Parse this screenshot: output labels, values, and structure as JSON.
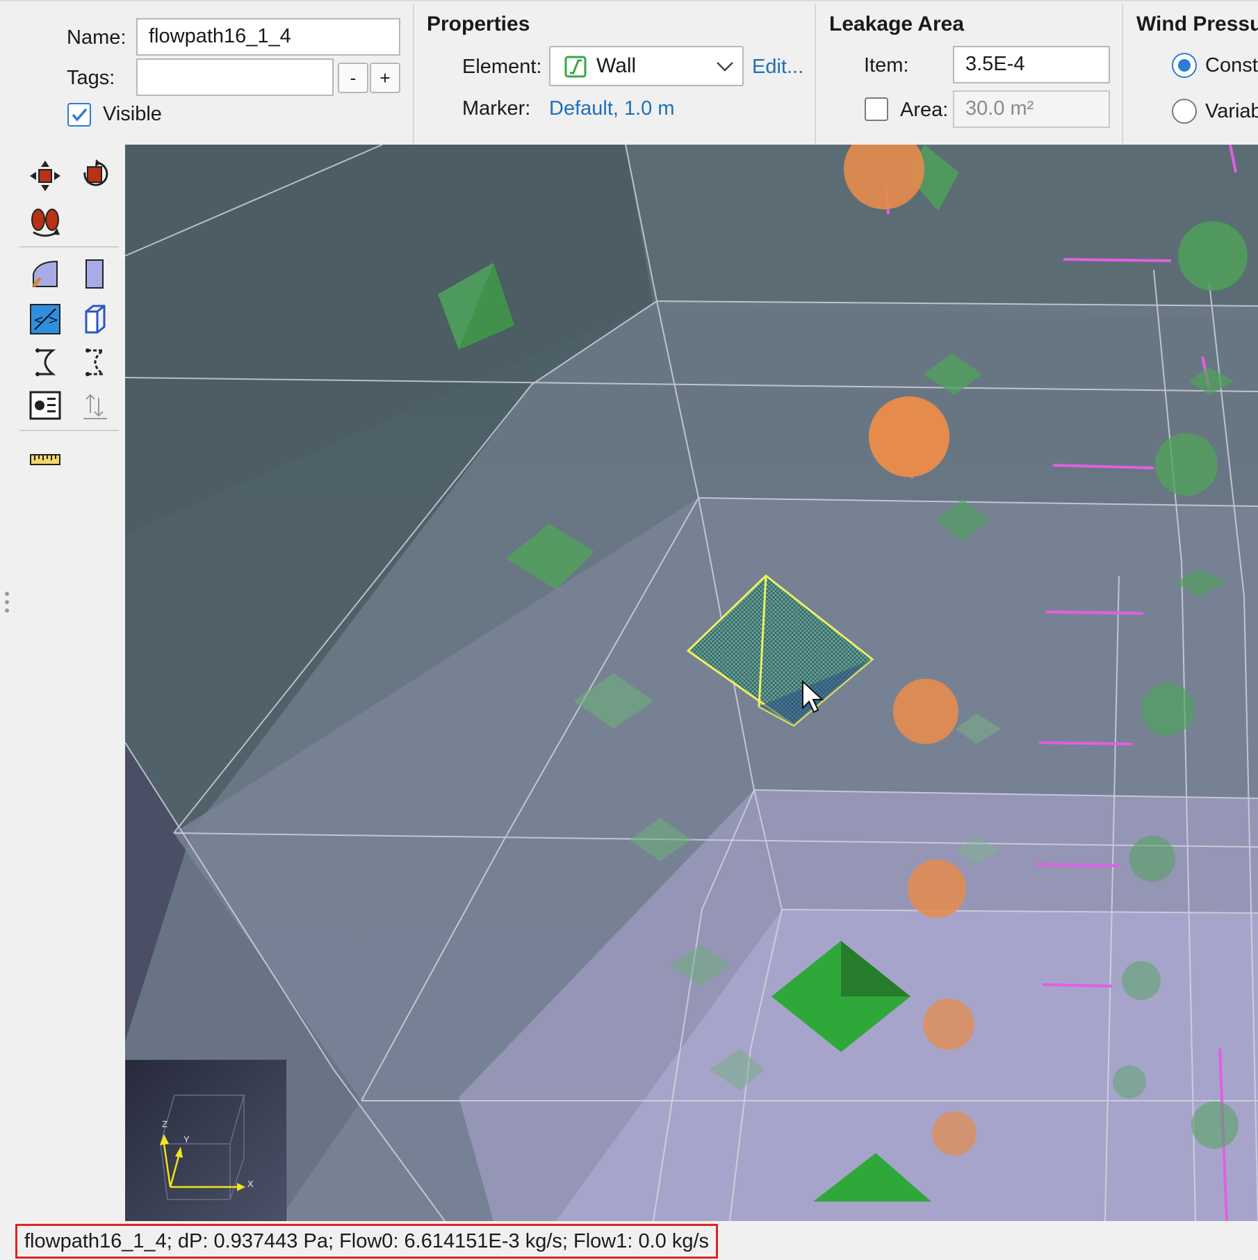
{
  "name_panel": {
    "name_label": "Name:",
    "name_value": "flowpath16_1_4",
    "tags_label": "Tags:",
    "tags_value": "",
    "minus_label": "-",
    "plus_label": "+",
    "visible_label": "Visible",
    "visible_checked": true
  },
  "properties": {
    "title": "Properties",
    "element_label": "Element:",
    "element_value": "Wall",
    "edit_link": "Edit...",
    "marker_label": "Marker:",
    "marker_value": "Default, 1.0 m"
  },
  "leakage": {
    "title": "Leakage Area",
    "item_label": "Item:",
    "item_value": "3.5E-4",
    "area_label": "Area:",
    "area_value": "30.0 m²",
    "area_checked": false
  },
  "wind": {
    "title": "Wind Pressu",
    "option_constant": "Const",
    "option_variable": "Variab",
    "selected": "constant"
  },
  "toolbox": {
    "icons": [
      "move-icon",
      "rotate-icon",
      "orbit-icon",
      "zone-icon",
      "wall-icon",
      "flowpath-icon",
      "duct-icon",
      "link-icon",
      "link-dashed-icon",
      "controls-icon",
      "sort-icon",
      "ruler-icon"
    ]
  },
  "axis_gizmo": {
    "x_label": "X",
    "y_label": "Y",
    "z_label": "Z"
  },
  "status_bar": {
    "text": "flowpath16_1_4; dP: 0.937443 Pa; Flow0: 6.614151E-3 kg/s; Flow1: 0.0 kg/s"
  },
  "colors": {
    "accent": "#2b7cd3",
    "link": "#1e6fb8",
    "highlight_border": "#e02424",
    "node_green": "#4fa45a",
    "node_orange": "#e58c4c",
    "selected_yellow": "#f0f060",
    "pipe_magenta": "#e060e0"
  }
}
